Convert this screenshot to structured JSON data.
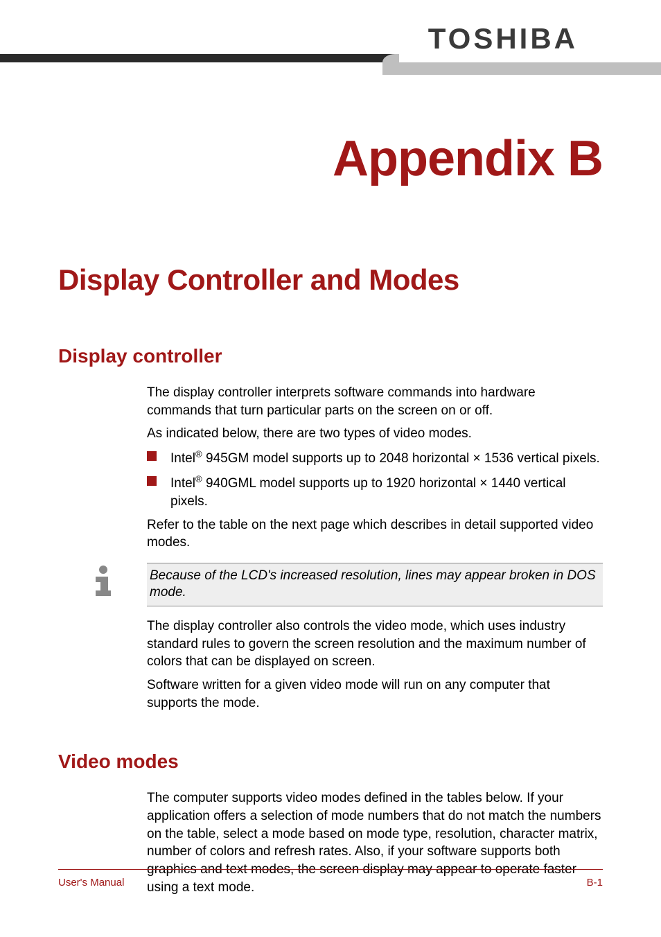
{
  "header": {
    "brand": "TOSHIBA"
  },
  "appendix": {
    "title": "Appendix B"
  },
  "page": {
    "title": "Display Controller and Modes"
  },
  "sections": {
    "display_controller": {
      "title": "Display controller",
      "para1": "The display controller interprets software commands into hardware commands that turn particular parts on the screen on or off.",
      "para2": "As indicated below, there are two types of video modes.",
      "bullets": [
        "Intel® 945GM model supports up to 2048 horizontal × 1536 vertical pixels.",
        "Intel® 940GML model supports up to 1920 horizontal × 1440 vertical pixels."
      ],
      "para3": "Refer to the table on the next page which describes in detail supported video modes.",
      "note": "Because of the LCD's increased resolution, lines may appear broken in DOS mode.",
      "para4": "The display controller also controls the video mode, which uses industry standard rules to govern the screen resolution and the maximum number of colors that can be displayed on screen.",
      "para5": "Software written for a given video mode will run on any computer that supports the mode."
    },
    "video_modes": {
      "title": "Video modes",
      "para1": "The computer supports video modes defined in the tables below. If your application offers a selection of mode numbers that do not match the numbers on the table, select a mode based on mode type, resolution, character matrix, number of colors and refresh rates. Also, if your software supports both graphics and text modes, the screen display may appear to operate faster using a text mode."
    }
  },
  "footer": {
    "left": "User's Manual",
    "right": "B-1"
  }
}
